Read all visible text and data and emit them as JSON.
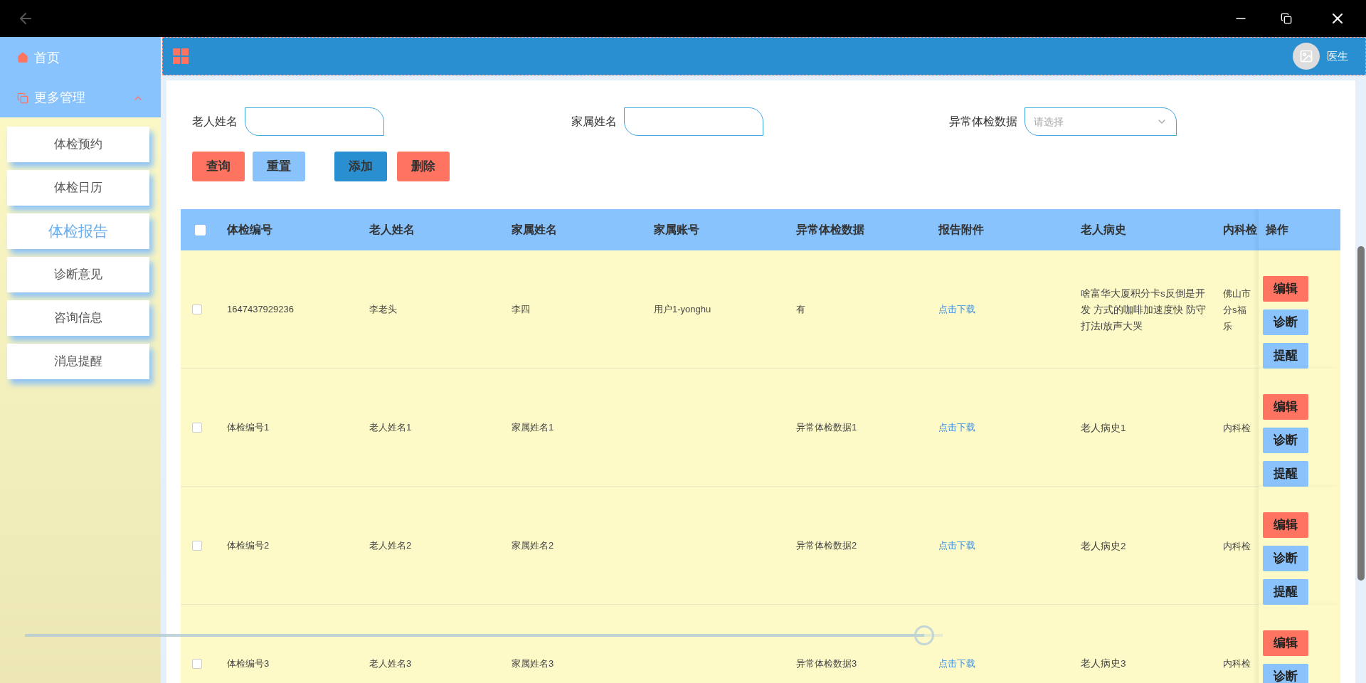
{
  "sidebar": {
    "items": [
      {
        "kind": "home",
        "label": "首页"
      },
      {
        "kind": "group",
        "label": "更多管理",
        "expanded": true,
        "children": [
          {
            "label": "体检预约",
            "selected": false
          },
          {
            "label": "体检日历",
            "selected": false
          },
          {
            "label": "体检报告",
            "selected": true
          },
          {
            "label": "诊断意见",
            "selected": false
          },
          {
            "label": "咨询信息",
            "selected": false
          },
          {
            "label": "消息提醒",
            "selected": false
          }
        ]
      }
    ]
  },
  "header": {
    "user": "医生"
  },
  "filters": [
    {
      "kind": "text",
      "label": "老人姓名"
    },
    {
      "kind": "text",
      "label": "家属姓名"
    },
    {
      "kind": "select",
      "label": "异常体检数据",
      "placeholder": "请选择"
    }
  ],
  "buttons": [
    {
      "kind": "danger",
      "label": "查询"
    },
    {
      "kind": "light",
      "label": "重置"
    },
    {
      "kind": "primary",
      "label": "添加"
    },
    {
      "kind": "danger",
      "label": "删除"
    }
  ],
  "table": {
    "all_checked": false,
    "columns": [
      "体检编号",
      "老人姓名",
      "家属姓名",
      "家属账号",
      "异常体检数据",
      "报告附件",
      "老人病史",
      "内科检"
    ],
    "action_column": "操作",
    "rows": [
      {
        "checked": false,
        "id": "1647437929236",
        "elder": "李老头",
        "family": "李四",
        "account": "用户1-yonghu",
        "abnormal": "有",
        "attachment": "点击下载",
        "history": "啥富华大厦积分卡s反倒是开发 方式的咖啡加速度快 防守打法l放声大哭",
        "internal": [
          "佛山市",
          "分s福",
          "乐"
        ],
        "actions": [
          "编辑",
          "诊断",
          "提醒"
        ]
      },
      {
        "checked": false,
        "id": "体检编号1",
        "elder": "老人姓名1",
        "family": "家属姓名1",
        "abnormal": "异常体检数据1",
        "attachment": "点击下载",
        "history": "老人病史1",
        "internal": [
          "内科检"
        ],
        "actions": [
          "编辑",
          "诊断",
          "提醒"
        ]
      },
      {
        "checked": false,
        "id": "体检编号2",
        "elder": "老人姓名2",
        "family": "家属姓名2",
        "abnormal": "异常体检数据2",
        "attachment": "点击下载",
        "history": "老人病史2",
        "internal": [
          "内科检"
        ],
        "actions": [
          "编辑",
          "诊断",
          "提醒"
        ]
      },
      {
        "checked": false,
        "id": "体检编号3",
        "elder": "老人姓名3",
        "family": "家属姓名3",
        "abnormal": "异常体检数据3",
        "attachment": "点击下载",
        "history": "老人病史3",
        "internal": [
          "内科检"
        ],
        "actions": [
          "编辑",
          "诊断"
        ]
      }
    ]
  },
  "player": {
    "level": 0.98
  }
}
